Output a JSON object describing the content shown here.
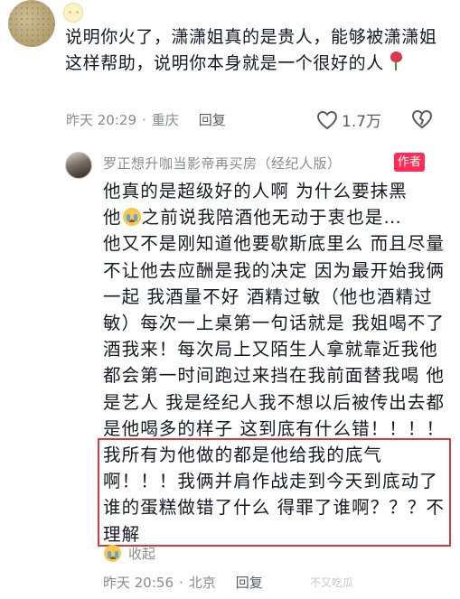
{
  "comment1": {
    "text": "说明你火了，潇潇姐真的是贵人，能够被潇潇姐这样帮助，说明你本身就是一个很好的人",
    "emoji": "rose",
    "time": "昨天 20:29",
    "location": "重庆",
    "reply_label": "回复",
    "like_count": "1.7万",
    "separator": "·"
  },
  "reply": {
    "author": "罗正想升咖当影帝再买房（经纪人版）",
    "badge": "作者",
    "line1": "他真的是超级好的人啊 为什么要抹黑",
    "line2_pre": "他",
    "line2_post": "之前说我陪酒他无动于衷也是…",
    "body_rest": "他又不是刚知道他要歇斯底里么 而且尽量不让他去应酬是我的决定 因为最开始我俩一起 我酒量不好 酒精过敏（他也酒精过敏）每次一上桌第一句话就是 我姐喝不了酒我来！每次局上又陌生人拿就靠近我他都会第一时间跑过来挡在我前面替我喝 他是艺人 我是经纪人我不想以后被传出去都是他喝多的样子 这到底有什么错！！！！我所有为他做的都是他给我的底气啊！！！我俩并肩作战走到今天到底动了谁的蛋糕做错了什么 得罪了谁啊？？？不理解",
    "collapse_label": "收起",
    "time": "昨天 20:56",
    "location": "北京",
    "reply_label": "回复",
    "separator": "·"
  },
  "watermark": "不又吃瓜",
  "colors": {
    "accent_red": "#ff2c55",
    "highlight_border": "#d63a3a",
    "meta_gray": "#8a8b91"
  },
  "icons": {
    "like": "heart-outline-icon",
    "dislike": "broken-heart-icon",
    "avatar1": "avatar",
    "rose": "rose-icon",
    "cry": "crying-face-icon"
  }
}
